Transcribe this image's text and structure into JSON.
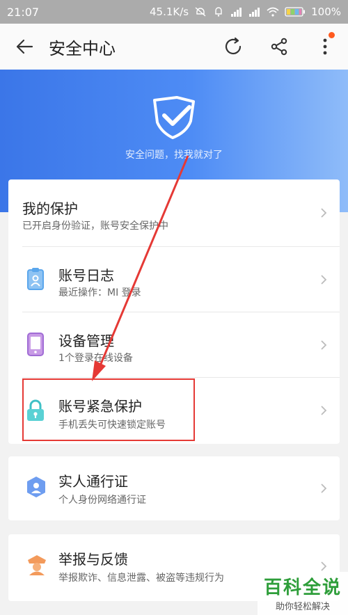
{
  "status_bar": {
    "time": "21:07",
    "speed": "45.1K/s",
    "battery": "100%"
  },
  "toolbar": {
    "title": "安全中心"
  },
  "banner": {
    "slogan": "安全问题，找我就对了"
  },
  "card1": {
    "rows": [
      {
        "label": "我的保护",
        "sub": "已开启身份验证，账号安全保护中"
      },
      {
        "label": "账号日志",
        "sub": "最近操作：MI 登录"
      },
      {
        "label": "设备管理",
        "sub": "1个登录在线设备"
      },
      {
        "label": "账号紧急保护",
        "sub": "手机丢失可快速锁定账号"
      }
    ]
  },
  "card2": {
    "label": "实人通行证",
    "sub": "个人身份网络通行证"
  },
  "card3": {
    "label": "举报与反馈",
    "sub": "举报欺诈、信息泄露、被盗等违规行为"
  },
  "watermark": {
    "title": "百科全说",
    "sub": "助你轻松解决"
  },
  "colors": {
    "accent": "#3b76e8",
    "annotation": "#e53935",
    "watermark": "#2e9e3a"
  },
  "icons": [
    "back-arrow-icon",
    "refresh-icon",
    "share-icon",
    "more-icon",
    "shield-icon",
    "account-log-icon",
    "device-icon",
    "lock-icon",
    "verified-shield-icon",
    "police-icon",
    "chevron-right-icon"
  ]
}
